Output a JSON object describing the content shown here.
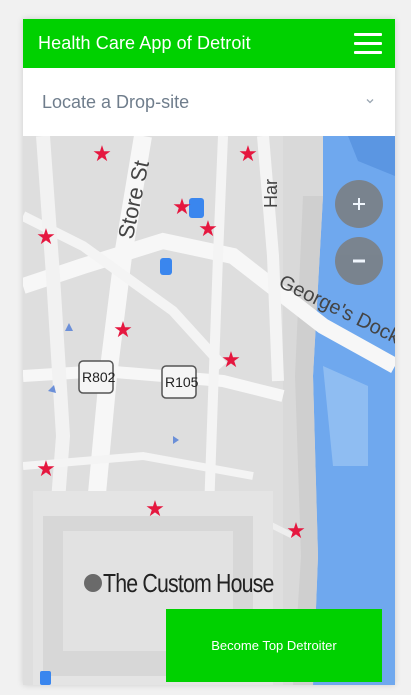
{
  "header": {
    "title": "Health Care App of Detroit"
  },
  "dropsite_select": {
    "value": "Locate a Drop-site"
  },
  "map": {
    "labels": {
      "store_st": "Store St",
      "georges_dock": "George's Dock",
      "custom_house": "The Custom House",
      "road_r802": "R802",
      "road_r105": "R105",
      "partial_street": "Har"
    },
    "zoom_in_symbol": "+",
    "zoom_out_symbol": "−",
    "marker_color": "#e5173f"
  },
  "cta": {
    "label": "Become Top Detroiter"
  },
  "colors": {
    "brand_green": "#00d100",
    "water_blue": "#6fa8ee",
    "zoom_button": "#7b7f84"
  }
}
